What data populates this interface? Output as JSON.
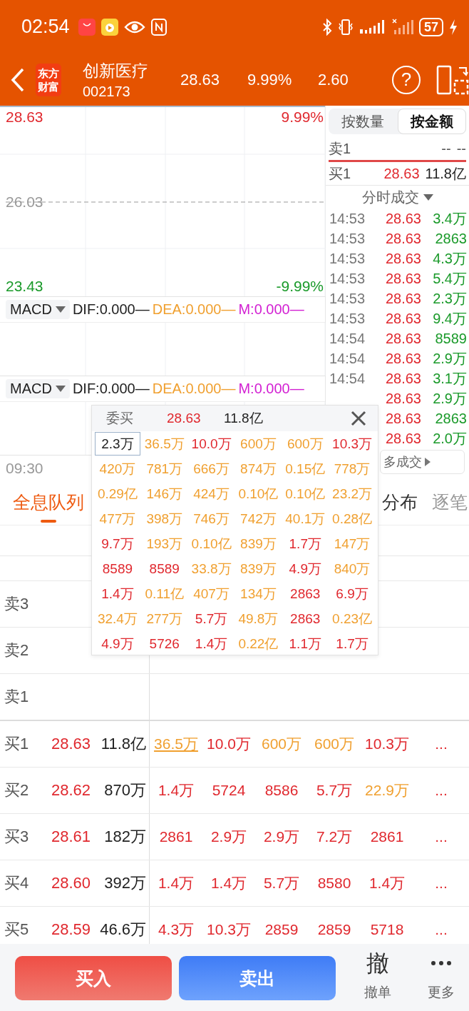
{
  "status_bar": {
    "time": "02:54",
    "battery": "57"
  },
  "header": {
    "logo_lines": [
      "东方",
      "财富"
    ],
    "name": "创新医疗",
    "code": "002173",
    "price": "28.63",
    "change_pct": "9.99%",
    "change": "2.60",
    "help": "?"
  },
  "chart": {
    "high": "28.63",
    "high_pct": "9.99%",
    "base": "26.03",
    "low": "23.43",
    "low_pct": "-9.99%",
    "time_start": "09:30",
    "indicators": [
      {
        "name": "MACD",
        "dif": "DIF:0.000—",
        "dea": "DEA:0.000—",
        "m": "M:0.000—"
      },
      {
        "name": "MACD",
        "dif": "DIF:0.000—",
        "dea": "DEA:0.000—",
        "m": "M:0.000—"
      }
    ]
  },
  "depth": {
    "modes": [
      {
        "label": "按数量",
        "selected": false
      },
      {
        "label": "按金额",
        "selected": true
      }
    ],
    "levels": [
      {
        "kind": "sell",
        "label": "卖1",
        "price": "--",
        "volume": "--"
      },
      {
        "kind": "buy",
        "label": "买1",
        "price": "28.63",
        "volume": "11.8亿"
      }
    ]
  },
  "trades": {
    "title": "分时成交",
    "more": "多成交",
    "rows": [
      {
        "time": "14:53",
        "price": "28.63",
        "volume": "3.4万"
      },
      {
        "time": "14:53",
        "price": "28.63",
        "volume": "2863"
      },
      {
        "time": "14:53",
        "price": "28.63",
        "volume": "4.3万"
      },
      {
        "time": "14:53",
        "price": "28.63",
        "volume": "5.4万"
      },
      {
        "time": "14:53",
        "price": "28.63",
        "volume": "2.3万"
      },
      {
        "time": "14:53",
        "price": "28.63",
        "volume": "9.4万"
      },
      {
        "time": "14:54",
        "price": "28.63",
        "volume": "8589"
      },
      {
        "time": "14:54",
        "price": "28.63",
        "volume": "2.9万"
      },
      {
        "time": "14:54",
        "price": "28.63",
        "volume": "3.1万"
      },
      {
        "price": "28.63",
        "volume": "2.9万"
      },
      {
        "price": "28.63",
        "volume": "2863"
      },
      {
        "price": "28.63",
        "volume": "2.0万"
      }
    ]
  },
  "queue_tabs": [
    {
      "label": "全息队列",
      "selected": true
    },
    {
      "label": "分布",
      "selected": false
    },
    {
      "label": "逐笔",
      "selected": false
    }
  ],
  "order_book": {
    "sell": [
      {
        "label": "卖3"
      },
      {
        "label": "卖2"
      },
      {
        "label": "卖1"
      }
    ],
    "buy": [
      {
        "label": "买1",
        "price": "28.63",
        "volume": "11.8亿",
        "more": "...",
        "queue": [
          {
            "text": "36.5万",
            "color": "#f0a030",
            "selected": true
          },
          {
            "text": "10.0万",
            "color": "#e0282e",
            "selected": false
          },
          {
            "text": "600万",
            "color": "#f0a030",
            "selected": false
          },
          {
            "text": "600万",
            "color": "#f0a030",
            "selected": false
          },
          {
            "text": "10.3万",
            "color": "#e0282e",
            "selected": false
          }
        ]
      },
      {
        "label": "买2",
        "price": "28.62",
        "volume": "870万",
        "more": "...",
        "queue": [
          {
            "text": "1.4万",
            "color": "#e0282e",
            "selected": false
          },
          {
            "text": "5724",
            "color": "#e0282e",
            "selected": false
          },
          {
            "text": "8586",
            "color": "#e0282e",
            "selected": false
          },
          {
            "text": "5.7万",
            "color": "#e0282e",
            "selected": false
          },
          {
            "text": "22.9万",
            "color": "#f0a030",
            "selected": false
          }
        ]
      },
      {
        "label": "买3",
        "price": "28.61",
        "volume": "182万",
        "more": "...",
        "queue": [
          {
            "text": "2861",
            "color": "#e0282e",
            "selected": false
          },
          {
            "text": "2.9万",
            "color": "#e0282e",
            "selected": false
          },
          {
            "text": "2.9万",
            "color": "#e0282e",
            "selected": false
          },
          {
            "text": "7.2万",
            "color": "#e0282e",
            "selected": false
          },
          {
            "text": "2861",
            "color": "#e0282e",
            "selected": false
          }
        ]
      },
      {
        "label": "买4",
        "price": "28.60",
        "volume": "392万",
        "more": "...",
        "queue": [
          {
            "text": "1.4万",
            "color": "#e0282e",
            "selected": false
          },
          {
            "text": "1.4万",
            "color": "#e0282e",
            "selected": false
          },
          {
            "text": "5.7万",
            "color": "#e0282e",
            "selected": false
          },
          {
            "text": "8580",
            "color": "#e0282e",
            "selected": false
          },
          {
            "text": "1.4万",
            "color": "#e0282e",
            "selected": false
          }
        ]
      },
      {
        "label": "买5",
        "price": "28.59",
        "volume": "46.6万",
        "more": "...",
        "queue": [
          {
            "text": "4.3万",
            "color": "#e0282e",
            "selected": false
          },
          {
            "text": "10.3万",
            "color": "#e0282e",
            "selected": false
          },
          {
            "text": "2859",
            "color": "#e0282e",
            "selected": false
          },
          {
            "text": "2859",
            "color": "#e0282e",
            "selected": false
          },
          {
            "text": "5718",
            "color": "#e0282e",
            "selected": false
          }
        ]
      }
    ]
  },
  "popup": {
    "side": "委买",
    "price": "28.63",
    "volume": "11.8亿",
    "rows": [
      [
        {
          "text": "2.3万",
          "color": "#222222",
          "selected": true
        },
        {
          "text": "36.5万",
          "color": "#f0a030",
          "selected": false
        },
        {
          "text": "10.0万",
          "color": "#e0282e",
          "selected": false
        },
        {
          "text": "600万",
          "color": "#f0a030",
          "selected": false
        },
        {
          "text": "600万",
          "color": "#f0a030",
          "selected": false
        },
        {
          "text": "10.3万",
          "color": "#e0282e",
          "selected": false
        }
      ],
      [
        {
          "text": "420万",
          "color": "#f0a030",
          "selected": false
        },
        {
          "text": "781万",
          "color": "#f0a030",
          "selected": false
        },
        {
          "text": "666万",
          "color": "#f0a030",
          "selected": false
        },
        {
          "text": "874万",
          "color": "#f0a030",
          "selected": false
        },
        {
          "text": "0.15亿",
          "color": "#f0a030",
          "selected": false
        },
        {
          "text": "778万",
          "color": "#f0a030",
          "selected": false
        }
      ],
      [
        {
          "text": "0.29亿",
          "color": "#f0a030",
          "selected": false
        },
        {
          "text": "146万",
          "color": "#f0a030",
          "selected": false
        },
        {
          "text": "424万",
          "color": "#f0a030",
          "selected": false
        },
        {
          "text": "0.10亿",
          "color": "#f0a030",
          "selected": false
        },
        {
          "text": "0.10亿",
          "color": "#f0a030",
          "selected": false
        },
        {
          "text": "23.2万",
          "color": "#f0a030",
          "selected": false
        }
      ],
      [
        {
          "text": "477万",
          "color": "#f0a030",
          "selected": false
        },
        {
          "text": "398万",
          "color": "#f0a030",
          "selected": false
        },
        {
          "text": "746万",
          "color": "#f0a030",
          "selected": false
        },
        {
          "text": "742万",
          "color": "#f0a030",
          "selected": false
        },
        {
          "text": "40.1万",
          "color": "#f0a030",
          "selected": false
        },
        {
          "text": "0.28亿",
          "color": "#f0a030",
          "selected": false
        }
      ],
      [
        {
          "text": "9.7万",
          "color": "#e0282e",
          "selected": false
        },
        {
          "text": "193万",
          "color": "#f0a030",
          "selected": false
        },
        {
          "text": "0.10亿",
          "color": "#f0a030",
          "selected": false
        },
        {
          "text": "839万",
          "color": "#f0a030",
          "selected": false
        },
        {
          "text": "1.7万",
          "color": "#e0282e",
          "selected": false
        },
        {
          "text": "147万",
          "color": "#f0a030",
          "selected": false
        }
      ],
      [
        {
          "text": "8589",
          "color": "#e0282e",
          "selected": false
        },
        {
          "text": "8589",
          "color": "#e0282e",
          "selected": false
        },
        {
          "text": "33.8万",
          "color": "#f0a030",
          "selected": false
        },
        {
          "text": "839万",
          "color": "#f0a030",
          "selected": false
        },
        {
          "text": "4.9万",
          "color": "#e0282e",
          "selected": false
        },
        {
          "text": "840万",
          "color": "#f0a030",
          "selected": false
        }
      ],
      [
        {
          "text": "1.4万",
          "color": "#e0282e",
          "selected": false
        },
        {
          "text": "0.11亿",
          "color": "#f0a030",
          "selected": false
        },
        {
          "text": "407万",
          "color": "#f0a030",
          "selected": false
        },
        {
          "text": "134万",
          "color": "#f0a030",
          "selected": false
        },
        {
          "text": "2863",
          "color": "#e0282e",
          "selected": false
        },
        {
          "text": "6.9万",
          "color": "#e0282e",
          "selected": false
        }
      ],
      [
        {
          "text": "32.4万",
          "color": "#f0a030",
          "selected": false
        },
        {
          "text": "277万",
          "color": "#f0a030",
          "selected": false
        },
        {
          "text": "5.7万",
          "color": "#e0282e",
          "selected": false
        },
        {
          "text": "49.8万",
          "color": "#f0a030",
          "selected": false
        },
        {
          "text": "2863",
          "color": "#e0282e",
          "selected": false
        },
        {
          "text": "0.23亿",
          "color": "#f0a030",
          "selected": false
        }
      ],
      [
        {
          "text": "4.9万",
          "color": "#e0282e",
          "selected": false
        },
        {
          "text": "5726",
          "color": "#e0282e",
          "selected": false
        },
        {
          "text": "1.4万",
          "color": "#e0282e",
          "selected": false
        },
        {
          "text": "0.22亿",
          "color": "#f0a030",
          "selected": false
        },
        {
          "text": "1.1万",
          "color": "#e0282e",
          "selected": false
        },
        {
          "text": "1.7万",
          "color": "#e0282e",
          "selected": false
        }
      ]
    ]
  },
  "actions": {
    "buy": "买入",
    "sell": "卖出",
    "cancel_glyph": "撤",
    "cancel": "撤单",
    "more": "更多"
  }
}
